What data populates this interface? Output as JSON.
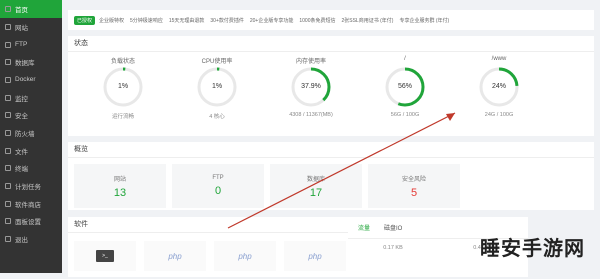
{
  "sidebar": {
    "items": [
      {
        "label": "首页",
        "icon": "home-icon"
      },
      {
        "label": "网站",
        "icon": "globe-icon"
      },
      {
        "label": "FTP",
        "icon": "ftp-icon"
      },
      {
        "label": "数据库",
        "icon": "database-icon"
      },
      {
        "label": "Docker",
        "icon": "docker-icon"
      },
      {
        "label": "监控",
        "icon": "monitor-icon"
      },
      {
        "label": "安全",
        "icon": "shield-icon"
      },
      {
        "label": "防火墙",
        "icon": "firewall-icon"
      },
      {
        "label": "文件",
        "icon": "folder-icon"
      },
      {
        "label": "终端",
        "icon": "terminal-icon"
      },
      {
        "label": "计划任务",
        "icon": "clock-icon"
      },
      {
        "label": "软件商店",
        "icon": "store-icon"
      },
      {
        "label": "面板设置",
        "icon": "gear-icon"
      },
      {
        "label": "退出",
        "icon": "logout-icon"
      }
    ]
  },
  "topbar": {
    "badge": "已授权",
    "items": [
      "企业版特权",
      "5分钟极速响应",
      "15天无理由退款",
      "30+款付费插件",
      "20+企业版专享功能",
      "1000条免费短信",
      "2张SSL商用证书 (年付)",
      "专享企业服务群 (年付)"
    ]
  },
  "status": {
    "title": "状态",
    "gauges": [
      {
        "label": "负载状态",
        "value": "1%",
        "percent": 1,
        "sub": "运行流畅"
      },
      {
        "label": "CPU使用率",
        "value": "1%",
        "percent": 1,
        "sub": "4 核心"
      },
      {
        "label": "内存使用率",
        "value": "37.9%",
        "percent": 37.9,
        "sub": "4308 / 11367(MB)"
      },
      {
        "label": "/",
        "value": "56%",
        "percent": 56,
        "sub": "56G / 100G"
      },
      {
        "label": "/www",
        "value": "24%",
        "percent": 24,
        "sub": "24G / 100G"
      }
    ]
  },
  "overview": {
    "title": "概览",
    "stats": [
      {
        "label": "网站",
        "value": "13",
        "color": "#20a53a"
      },
      {
        "label": "FTP",
        "value": "0",
        "color": "#20a53a"
      },
      {
        "label": "数据库",
        "value": "17",
        "color": "#20a53a"
      },
      {
        "label": "安全风险",
        "value": "5",
        "color": "#e53935"
      }
    ]
  },
  "software": {
    "title": "软件",
    "items": [
      "terminal",
      "php",
      "php",
      "php"
    ]
  },
  "traffic": {
    "tabs": [
      "流量",
      "磁盘IO"
    ],
    "up_value": "0.17 KB",
    "down_value": "0.47 KB"
  },
  "watermark": "睡安手游网",
  "accent": "#20a53a"
}
